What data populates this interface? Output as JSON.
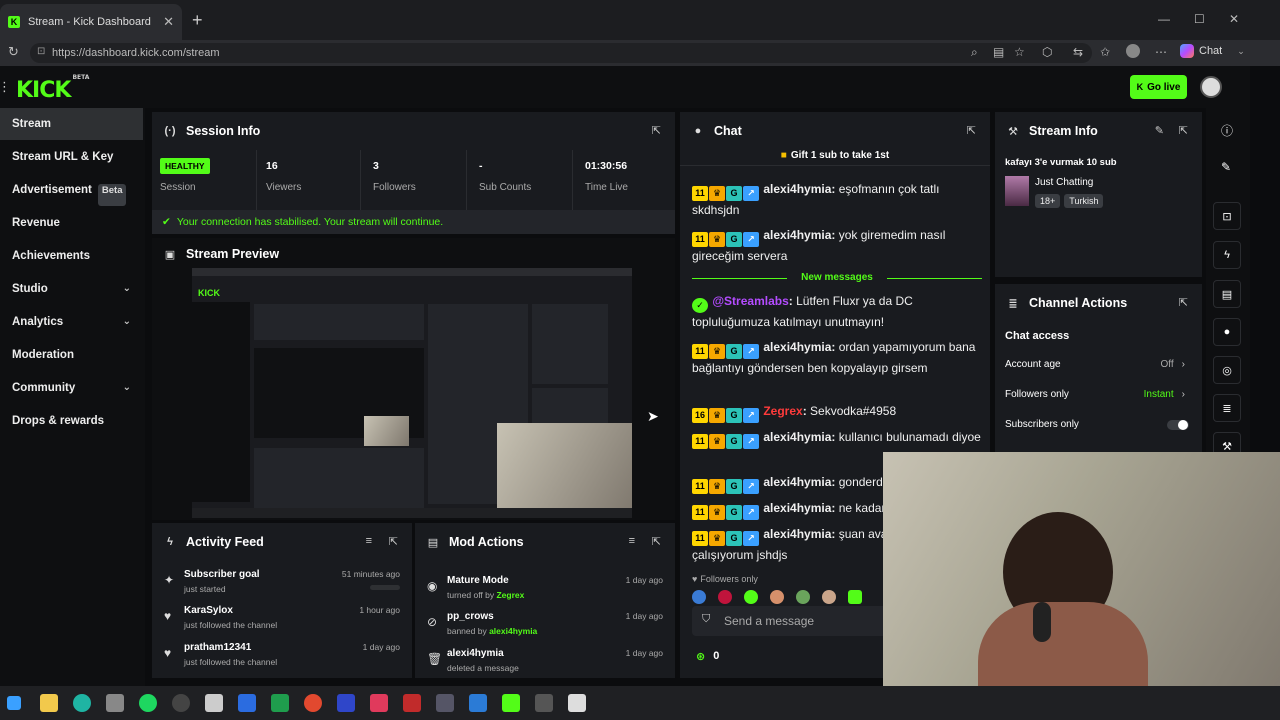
{
  "browser": {
    "tab_title": "Stream - Kick Dashboard",
    "url": "https://dashboard.kick.com/stream",
    "copilot_label": "Chat"
  },
  "header": {
    "logo": "KICK",
    "logo_sup": "BETA",
    "go_live_label": "Go live"
  },
  "sidebar": {
    "items": [
      {
        "label": "Stream",
        "active": true
      },
      {
        "label": "Stream URL & Key"
      },
      {
        "label": "Advertisement",
        "badge": "Beta"
      },
      {
        "label": "Revenue"
      },
      {
        "label": "Achievements"
      },
      {
        "label": "Studio",
        "chevron": true
      },
      {
        "label": "Analytics",
        "chevron": true
      },
      {
        "label": "Moderation"
      },
      {
        "label": "Community",
        "chevron": true
      },
      {
        "label": "Drops & rewards"
      }
    ]
  },
  "session": {
    "title": "Session Info",
    "health": "HEALTHY",
    "session_label": "Session",
    "stats": [
      {
        "value": "16",
        "label": "Viewers"
      },
      {
        "value": "3",
        "label": "Followers"
      },
      {
        "value": "-",
        "label": "Sub Counts"
      },
      {
        "value": "01:30:56",
        "label": "Time Live"
      }
    ],
    "connection_msg": "Your connection has stabilised. Your stream will continue."
  },
  "preview": {
    "title": "Stream Preview"
  },
  "activity": {
    "title": "Activity Feed",
    "items": [
      {
        "title": "Subscriber goal",
        "sub": "just started",
        "time": "51 minutes ago"
      },
      {
        "title": "KaraSylox",
        "sub": "just followed the channel",
        "time": "1 hour ago"
      },
      {
        "title": "pratham12341",
        "sub": "just followed the channel",
        "time": "1 day ago"
      }
    ]
  },
  "mod_actions": {
    "title": "Mod Actions",
    "items": [
      {
        "title": "Mature Mode",
        "sub": "turned off by",
        "by": "Zegrex",
        "time": "1 day ago"
      },
      {
        "title": "pp_crows",
        "sub": "banned by",
        "by": "alexi4hymia",
        "time": "1 day ago"
      },
      {
        "title": "alexi4hymia",
        "sub": "deleted a message",
        "by": "",
        "time": "1 day ago"
      }
    ]
  },
  "chat": {
    "title": "Chat",
    "gift_banner": "Gift 1 sub to take 1st",
    "new_messages": "New messages",
    "followers_only": "Followers only",
    "input_placeholder": "Send a message",
    "points": "0",
    "messages": [
      {
        "badge": "11",
        "user": "alexi4hymia",
        "text": "eşofmanın çok tatlı skdhsjdn"
      },
      {
        "badge": "11",
        "user": "alexi4hymia",
        "text": "yok giremedim nasıl gireceğim servera"
      },
      {
        "badge": "",
        "user": "@Streamlabs",
        "text": "Lütfen Fluxr ya da DC topluluğumuza katılmayı unutmayın!"
      },
      {
        "badge": "11",
        "user": "alexi4hymia",
        "text": "ordan yapamıyorum bana bağlantıyı göndersen ben kopyalayıp girsem"
      },
      {
        "badge": "16",
        "user": "Zegrex",
        "text": "Sekvodka#4958"
      },
      {
        "badge": "11",
        "user": "alexi4hymia",
        "text": "kullanıcı bulunamadı diyoe"
      },
      {
        "badge": "11",
        "user": "alexi4hymia",
        "text": "gonderdim"
      },
      {
        "badge": "11",
        "user": "alexi4hymia",
        "text": "ne kadar düzeltme ya"
      },
      {
        "badge": "11",
        "user": "alexi4hymia",
        "text": "şuan avatar ayarlamaya çalışıyorum jshdjs"
      }
    ]
  },
  "stream_info": {
    "title": "Stream Info",
    "stream_title": "kafayı 3'e vurmak 10 sub",
    "category": "Just Chatting",
    "tags": [
      "18+",
      "Turkish"
    ]
  },
  "channel_actions": {
    "title": "Channel Actions",
    "section": "Chat access",
    "rows": [
      {
        "label": "Account age",
        "value": "Off"
      },
      {
        "label": "Followers only",
        "value": "Instant"
      },
      {
        "label": "Subscribers only",
        "value": ""
      }
    ]
  },
  "colors": {
    "accent": "#53fc18",
    "panel": "#191b1f",
    "bg": "#0b0c0e"
  }
}
